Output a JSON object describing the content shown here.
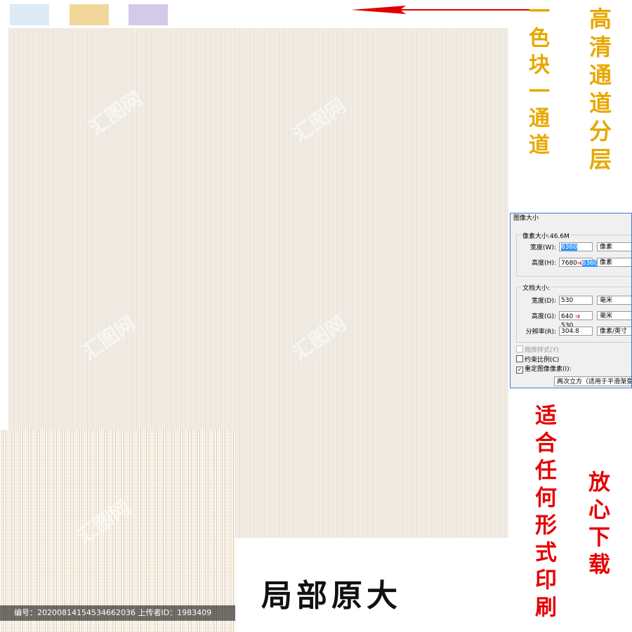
{
  "swatches": [
    {
      "name": "light-blue",
      "color": "#dcebf5"
    },
    {
      "name": "tan",
      "color": "#f2d79a"
    },
    {
      "name": "lavender",
      "color": "#d5c9ea"
    }
  ],
  "arrow": {
    "color": "#e10000",
    "icon": "arrow-left-icon"
  },
  "labels": {
    "color_channel": "一色块一通道",
    "hd_channel": "高清通道分层",
    "any_print": "适合任何形式印刷",
    "download": "放心下载",
    "zoom_title": "局部原大"
  },
  "watermark": {
    "text": "汇图网"
  },
  "id_bar": {
    "text": "编号：20200814154534662036 上传者ID：1983409"
  },
  "dialog": {
    "title": "图像大小",
    "pixel_group": {
      "label": "像素大小:46.6M",
      "width_label": "宽度(W):",
      "width_value": "6360",
      "width_unit": "像素",
      "height_label": "高度(H):",
      "height_old": "7680",
      "height_new": "6360",
      "height_unit": "像素"
    },
    "doc_group": {
      "label": "文档大小:",
      "width_label": "宽度(D):",
      "width_value": "530",
      "width_unit": "毫米",
      "height_label": "高度(G):",
      "height_old": "640",
      "height_new": "530",
      "height_unit": "毫米",
      "res_label": "分辨率(R):",
      "res_value": "304.8",
      "res_unit": "像素/英寸"
    },
    "scale_styles": "缩放样式(Y)",
    "constrain": "约束比例(C)",
    "resample": "重定图像像素(I):",
    "resample_method": "两次立方（适用于平滑渐变",
    "constrain_checked": false,
    "resample_checked": true
  }
}
